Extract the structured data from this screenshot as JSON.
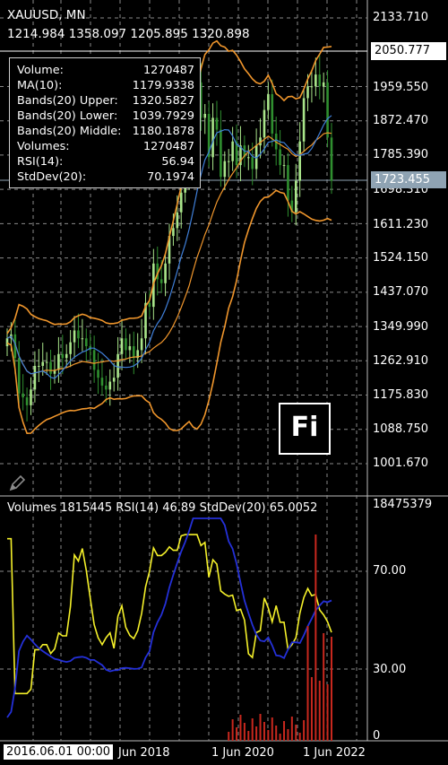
{
  "header": {
    "symbol": "XAUUSD, MN",
    "ohlc": "1214.984 1358.097 1205.895 1320.898"
  },
  "data_window": {
    "rows": [
      {
        "label": "Volume:",
        "value": "1270487"
      },
      {
        "label": "MA(10):",
        "value": "1179.9338"
      },
      {
        "label": "Bands(20) Upper:",
        "value": "1320.5827"
      },
      {
        "label": "Bands(20) Lower:",
        "value": "1039.7929"
      },
      {
        "label": "Bands(20) Middle:",
        "value": "1180.1878"
      },
      {
        "label": "Volumes:",
        "value": "1270487"
      },
      {
        "label": "RSI(14):",
        "value": "56.94"
      },
      {
        "label": "StdDev(20):",
        "value": "70.1974"
      }
    ]
  },
  "price_axis": {
    "labels": [
      "2133.710",
      "1959.550",
      "1872.470",
      "1785.390",
      "1698.310",
      "1611.230",
      "1524.150",
      "1437.070",
      "1349.990",
      "1262.910",
      "1175.830",
      "1088.750",
      "1001.670"
    ],
    "crosshair_price": "2050.777",
    "current_price": "1723.455"
  },
  "subwindow": {
    "label": "Volumes 1815445 RSI(14) 46.89 StdDev(20) 65.0052",
    "axis_labels": [
      "18475379",
      "70.00",
      "30.00",
      "0"
    ]
  },
  "time_axis": {
    "labels": [
      "2016.06.01 00:00",
      "Jun 2018",
      "1 Jun 2020",
      "1 Jun 2022"
    ]
  },
  "logo": {
    "text": "Fi"
  },
  "colors": {
    "background": "#000000",
    "bull_candle": "#a9e58a",
    "bear_candle": "#2f8f2f",
    "bands": "#f0962c",
    "ma": "#3f7fd8",
    "rsi": "#f4f02a",
    "stddev": "#2430d8",
    "volume": "#c8281e",
    "grid": "#8a8a8a"
  },
  "icons": {
    "edit": "pencil-icon"
  }
}
